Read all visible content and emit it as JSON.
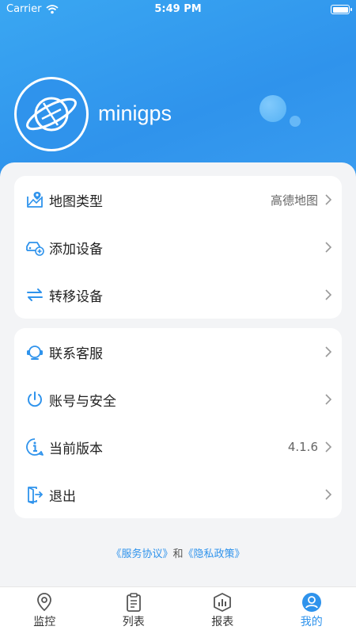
{
  "status_bar": {
    "carrier": "Carrier",
    "time": "5:49 PM"
  },
  "profile": {
    "name": "minigps"
  },
  "menu_group_1": [
    {
      "label": "地图类型",
      "value": "高德地图",
      "icon": "map-pin-icon"
    },
    {
      "label": "添加设备",
      "value": "",
      "icon": "car-add-icon"
    },
    {
      "label": "转移设备",
      "value": "",
      "icon": "transfer-arrows-icon"
    }
  ],
  "menu_group_2": [
    {
      "label": "联系客服",
      "value": "",
      "icon": "headset-icon"
    },
    {
      "label": "账号与安全",
      "value": "",
      "icon": "power-icon"
    },
    {
      "label": "当前版本",
      "value": "4.1.6",
      "icon": "info-icon"
    },
    {
      "label": "退出",
      "value": "",
      "icon": "logout-icon"
    }
  ],
  "footer_links": {
    "service": "《服务协议》",
    "and": "和",
    "privacy": "《隐私政策》"
  },
  "tabs": [
    {
      "label": "监控",
      "icon": "location-icon",
      "active": false
    },
    {
      "label": "列表",
      "icon": "clipboard-list-icon",
      "active": false
    },
    {
      "label": "报表",
      "icon": "chart-icon",
      "active": false
    },
    {
      "label": "我的",
      "icon": "user-icon",
      "active": true
    }
  ],
  "colors": {
    "accent": "#2f93ec",
    "header": "#3aa7f2",
    "background": "#f3f4f6"
  }
}
